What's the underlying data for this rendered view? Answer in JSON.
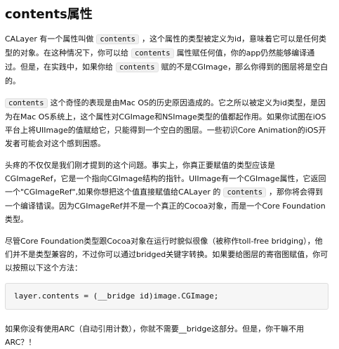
{
  "heading": {
    "code": "contents",
    "suffix": "属性"
  },
  "paragraphs": {
    "p1": {
      "a": "CALayer 有一个属性叫做",
      "code": "contents",
      "b": "，这个属性的类型被定义为id，意味着它可以是任何类型的对象。在这种情况下，你可以给",
      "code2": "contents",
      "c": "属性赋任何值，你的app仍然能够编译通过。但是，在实践中，如果你给",
      "code3": "contents",
      "d": "赋的不是CGImage，那么你得到的图层将是空白的。"
    },
    "p2": {
      "code": "contents",
      "a": "这个奇怪的表现是由Mac OS的历史原因造成的。它之所以被定义为id类型，是因为在Mac OS系统上，这个属性对CGImage和NSImage类型的值都起作用。如果你试图在iOS平台上将UIImage的值赋给它，只能得到一个空白的图层。一些初识Core Animation的iOS开发者可能会对这个感到困惑。"
    },
    "p3": {
      "a": "头疼的不仅仅是我们刚才提到的这个问题。事实上，你真正要赋值的类型应该是CGImageRef，它是一个指向CGImage结构的指针。UIImage有一个CGImage属性，它返回一个\"CGImageRef\",如果你想把这个值直接赋值给CALayer 的",
      "code": "contents",
      "b": "，那你将会得到一个编译错误。因为CGImageRef并不是一个真正的Cocoa对象，而是一个Core Foundation类型。"
    },
    "p4": {
      "a": "尽管Core Foundation类型跟Cocoa对象在运行时貌似很像（被称作toll-free bridging），他们并不是类型兼容的，不过你可以通过bridged关键字转换。如果要给图层的寄宿图赋值，你可以按照以下这个方法："
    },
    "code_block": "layer.contents = (__bridge id)image.CGImage;",
    "p5": {
      "a": "如果你没有使用ARC（自动引用计数），你就不需要__bridge这部分。但是，你干嘛不用ARC？！"
    }
  }
}
